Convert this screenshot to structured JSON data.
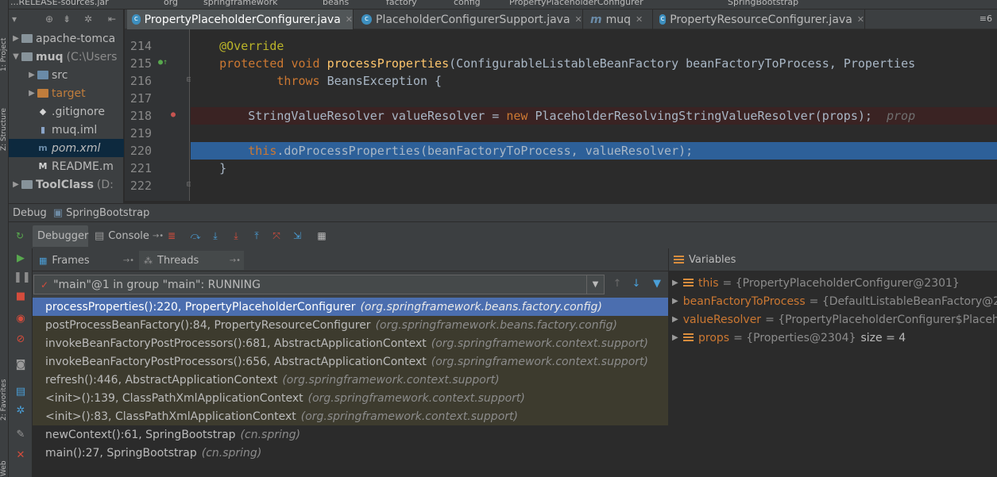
{
  "breadcrumb": [
    "...RELEASE-sources.jar",
    "org",
    "springframework",
    "beans",
    "factory",
    "config",
    "PropertyPlaceholderConfigurer"
  ],
  "run_config": "SpringBootstrap",
  "side_labels": {
    "project": "1: Project",
    "structure": "Z: Structure",
    "favorites": "2: Favorites",
    "web": "Web"
  },
  "project_tree": [
    {
      "label": "apache-tomca",
      "indent": 0,
      "kind": "folder",
      "arrow": "▶"
    },
    {
      "label": "muq",
      "extra": "(C:\\Users",
      "indent": 0,
      "kind": "folder",
      "arrow": "▼",
      "bold": true
    },
    {
      "label": "src",
      "indent": 1,
      "kind": "src",
      "arrow": "▶"
    },
    {
      "label": "target",
      "indent": 1,
      "kind": "target",
      "arrow": "▶"
    },
    {
      "label": ".gitignore",
      "indent": 1,
      "kind": "file",
      "icon": "◆"
    },
    {
      "label": "muq.iml",
      "indent": 1,
      "kind": "file",
      "icon": "▮"
    },
    {
      "label": "pom.xml",
      "indent": 1,
      "kind": "file",
      "icon": "m",
      "selected": true
    },
    {
      "label": "README.m",
      "indent": 1,
      "kind": "file",
      "icon": "M"
    },
    {
      "label": "ToolClass",
      "extra": "(D:",
      "indent": 0,
      "kind": "folder",
      "arrow": "▶",
      "bold": true
    }
  ],
  "tabs": [
    {
      "label": "PropertyPlaceholderConfigurer.java",
      "active": true
    },
    {
      "label": "PlaceholderConfigurerSupport.java",
      "active": false
    },
    {
      "label": "muq",
      "active": false
    },
    {
      "label": "PropertyResourceConfigurer.java",
      "active": false
    }
  ],
  "tab_overflow": "≡6",
  "code_lines": [
    {
      "num": "214",
      "text": "    @Override"
    },
    {
      "num": "215",
      "text": "    protected void processProperties(ConfigurableListableBeanFactory beanFactoryToProcess, Properties"
    },
    {
      "num": "216",
      "text": "            throws BeansException {"
    },
    {
      "num": "217",
      "text": ""
    },
    {
      "num": "218",
      "text": "        StringValueResolver valueResolver = new PlaceholderResolvingStringValueResolver(props);  prop"
    },
    {
      "num": "219",
      "text": ""
    },
    {
      "num": "220",
      "text": "        this.doProcessProperties(beanFactoryToProcess, valueResolver);"
    },
    {
      "num": "221",
      "text": "    }"
    },
    {
      "num": "222",
      "text": ""
    }
  ],
  "debug": {
    "title": "Debug",
    "config": "SpringBootstrap",
    "tabs": {
      "debugger": "Debugger",
      "console": "Console"
    },
    "frames_tab": "Frames",
    "threads_tab": "Threads",
    "thread": "\"main\"@1 in group \"main\": RUNNING",
    "variables_title": "Variables"
  },
  "frames": [
    {
      "method": "processProperties():220, PropertyPlaceholderConfigurer",
      "pkg": "(org.springframework.beans.factory.config)",
      "state": "selected"
    },
    {
      "method": "postProcessBeanFactory():84, PropertyResourceConfigurer",
      "pkg": "(org.springframework.beans.factory.config)",
      "state": "lib"
    },
    {
      "method": "invokeBeanFactoryPostProcessors():681, AbstractApplicationContext",
      "pkg": "(org.springframework.context.support)",
      "state": "lib"
    },
    {
      "method": "invokeBeanFactoryPostProcessors():656, AbstractApplicationContext",
      "pkg": "(org.springframework.context.support)",
      "state": "lib"
    },
    {
      "method": "refresh():446, AbstractApplicationContext",
      "pkg": "(org.springframework.context.support)",
      "state": "lib"
    },
    {
      "method": "<init>():139, ClassPathXmlApplicationContext",
      "pkg": "(org.springframework.context.support)",
      "state": "lib"
    },
    {
      "method": "<init>():83, ClassPathXmlApplicationContext",
      "pkg": "(org.springframework.context.support)",
      "state": "lib"
    },
    {
      "method": "newContext():61, SpringBootstrap",
      "pkg": "(cn.spring)",
      "state": "normal"
    },
    {
      "method": "main():27, SpringBootstrap",
      "pkg": "(cn.spring)",
      "state": "normal"
    }
  ],
  "variables": [
    {
      "name": "this",
      "value": "= {PropertyPlaceholderConfigurer@2301}",
      "suffix": ""
    },
    {
      "name": "beanFactoryToProcess",
      "value": "= {DefaultListableBeanFactory@2",
      "suffix": ""
    },
    {
      "name": "valueResolver",
      "value": "= {PropertyPlaceholderConfigurer$Placeh",
      "suffix": ""
    },
    {
      "name": "props",
      "value": "= {Properties@2304}",
      "suffix": "size = 4"
    }
  ]
}
